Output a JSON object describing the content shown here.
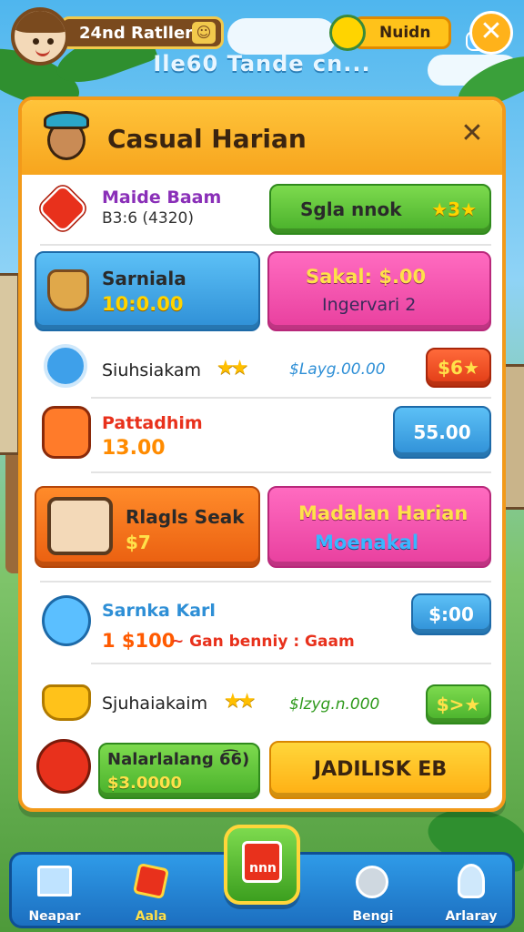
{
  "top_bar": {
    "player_name": "24nd Ratllen",
    "name_badge": "☺",
    "currency_label": "Nuidn",
    "close_symbol": "✕"
  },
  "subtitle": "Ilе60 Tande cn...",
  "panel": {
    "title": "Casual Harian",
    "close_symbol": "✕",
    "rows": {
      "r1": {
        "title": "Maide Baam",
        "sub": "B3:6 (4320)",
        "button": "Sgla nnok",
        "button_badge": "★3★"
      },
      "r2": {
        "left_title": "Sarniala",
        "left_value": "10:0.00",
        "right_title": "Sakal: $.00",
        "right_sub": "Ingervari 2"
      },
      "r3": {
        "title": "Siuhsiakam",
        "stars": "★★",
        "price": "$Layg.00.00",
        "button": "$6★"
      },
      "r4": {
        "title": "Pattadhim",
        "value": "13.00",
        "button": "55.00"
      },
      "r5": {
        "left_title": "Rlagls Seak",
        "left_value": "$7",
        "right_title": "Madalan Harian",
        "right_sub": "Moenakal"
      },
      "r6": {
        "title": "Sarnka Karl",
        "value": "1 $100",
        "note": "~ Gan benniy : Gaam",
        "button": "$:00"
      },
      "r7": {
        "title": "Sjuhaiakaim",
        "stars": "★★",
        "price": "$lzyg.n.000",
        "button": "$>★"
      },
      "r8": {
        "left_title": "Nalarlalang 6͡6)",
        "left_value": "$3.0000",
        "button": "JADILISK EB"
      }
    }
  },
  "bottom_nav": [
    {
      "label": "Neapar"
    },
    {
      "label": "Aala"
    },
    {
      "label": "nnn"
    },
    {
      "label": "Bengi"
    },
    {
      "label": "Arlaray"
    }
  ]
}
